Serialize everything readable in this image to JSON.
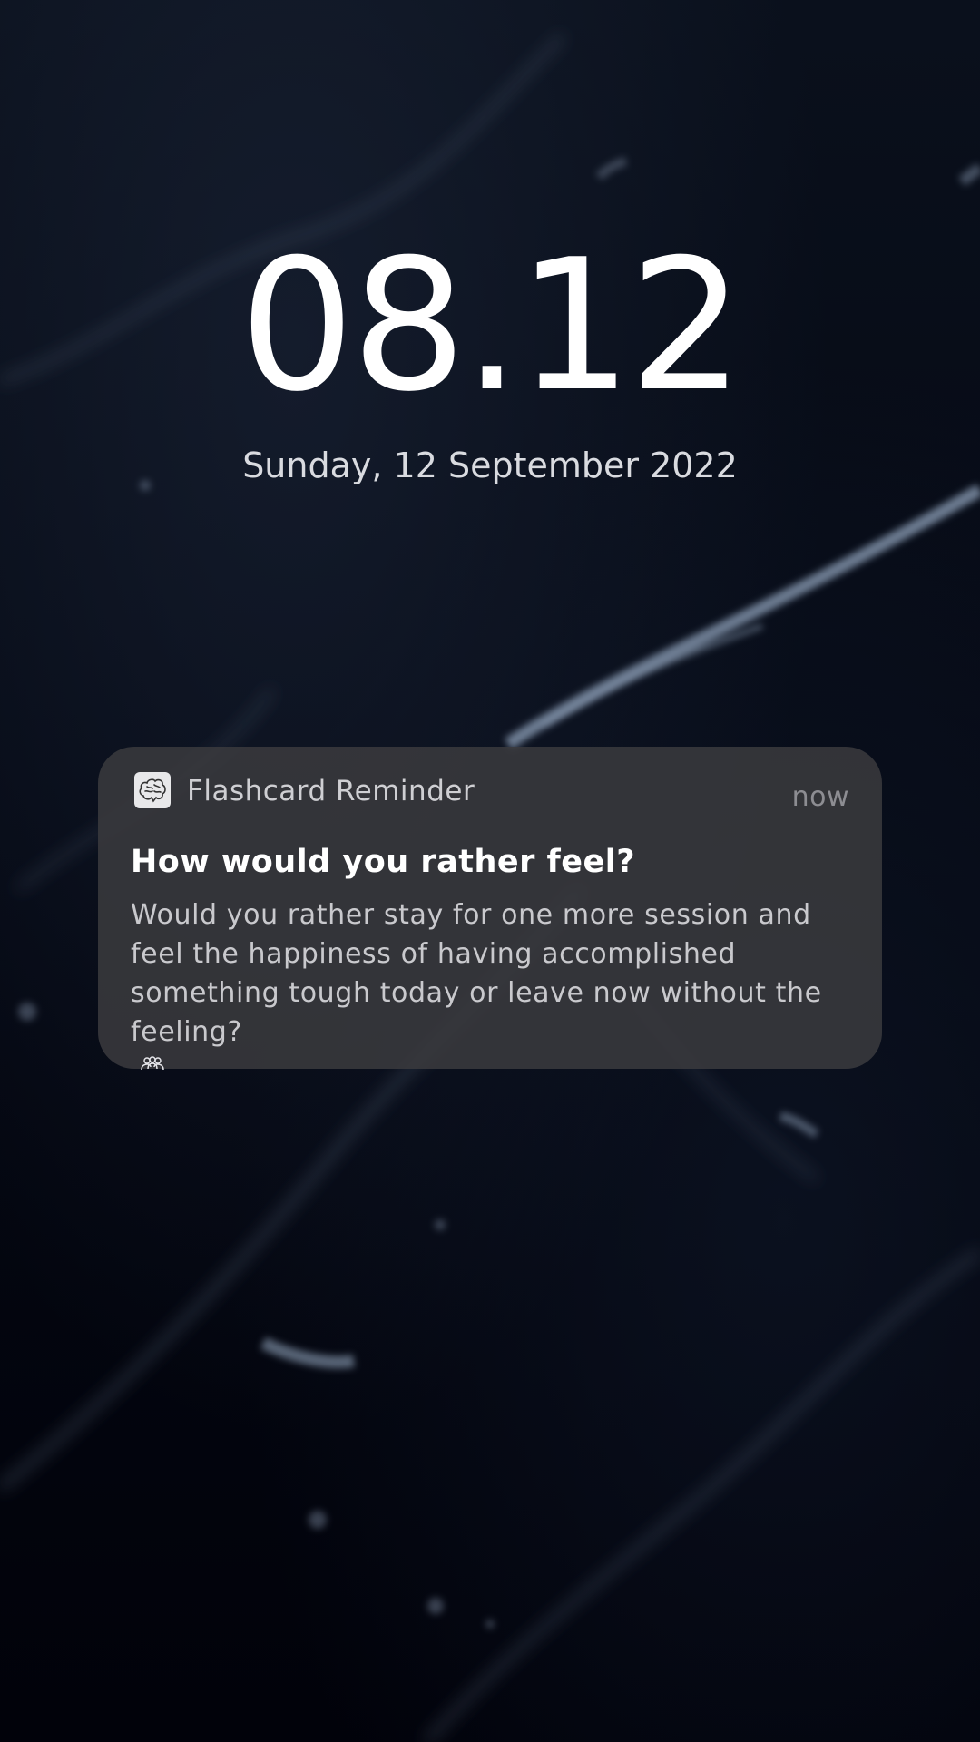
{
  "lockscreen": {
    "time": "08.12",
    "date": "Sunday, 12 September 2022"
  },
  "notification": {
    "app_icon": "brain-icon",
    "app_name": "Flashcard Reminder",
    "timestamp": "now",
    "title": "How would you rather feel?",
    "body": "Would you rather stay for one more session and feel the happiness of having accomplished something tough today or leave now without the feeling?",
    "extra_icon": "people-icon"
  },
  "colors": {
    "background": "#02040d",
    "notification_bg": "#3a3a3e",
    "text_primary": "#ffffff",
    "text_secondary": "#c9c9cd"
  }
}
